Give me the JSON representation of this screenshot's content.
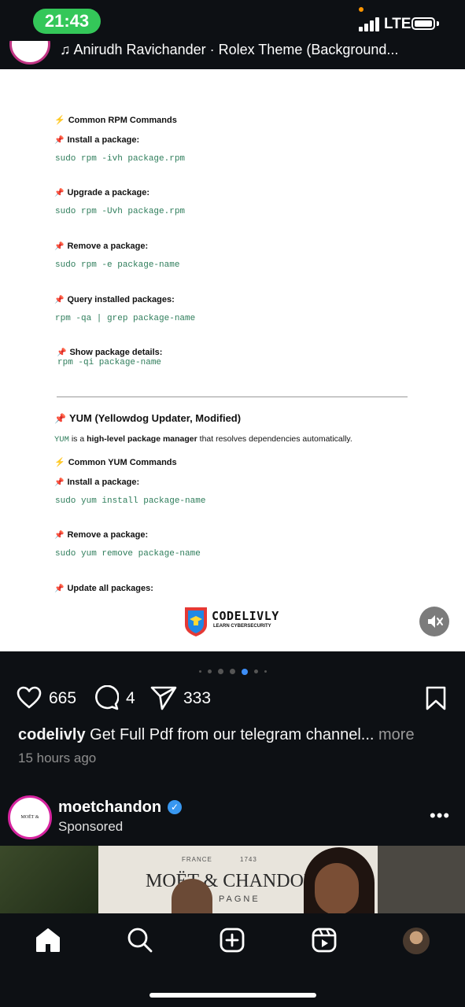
{
  "status_bar": {
    "time": "21:43",
    "network": "LTE"
  },
  "audio": {
    "text": "Anirudh Ravichander · Rolex Theme (Background..."
  },
  "post_image": {
    "common_rpm_heading": "Common RPM Commands",
    "rpm": [
      {
        "label": "Install a package:",
        "cmd": "sudo rpm -ivh package.rpm"
      },
      {
        "label": "Upgrade a package:",
        "cmd": "sudo rpm -Uvh package.rpm"
      },
      {
        "label": "Remove a package:",
        "cmd": "sudo rpm -e package-name"
      },
      {
        "label": "Query installed packages:",
        "cmd": "rpm -qa | grep package-name"
      },
      {
        "label": "Show package details:",
        "cmd": "rpm -qi package-name"
      }
    ],
    "yum_heading": "YUM (Yellowdog Updater, Modified)",
    "yum_intro_code": "YUM",
    "yum_intro_is": " is a ",
    "yum_intro_bold": "high-level package manager",
    "yum_intro_rest": " that resolves dependencies automatically.",
    "common_yum_heading": "Common YUM Commands",
    "yum": [
      {
        "label": "Install a package:",
        "cmd": "sudo yum install package-name"
      },
      {
        "label": "Remove a package:",
        "cmd": "sudo yum remove package-name"
      },
      {
        "label": "Update all packages:",
        "cmd": ""
      }
    ],
    "logo_title": "CODELIVLY",
    "logo_subtitle": "LEARN CYBERSECURITY"
  },
  "carousel": {
    "total_dots": 7,
    "active_index": 4
  },
  "actions": {
    "likes": "665",
    "comments": "4",
    "shares": "333"
  },
  "caption": {
    "username": "codelivly",
    "text": " Get Full Pdf from our telegram channel...",
    "more": " more",
    "time_ago": "15 hours ago"
  },
  "sponsored_post": {
    "username": "moetchandon",
    "label": "Sponsored",
    "avatar_text": "MOËT & CHANDON",
    "ad_france": "FRANCE",
    "ad_year": "1743",
    "ad_brand": "MOËT & CHANDON",
    "ad_sub": "PAGNE"
  },
  "colors": {
    "like_accent": "#f5f5f5",
    "verified": "#3897f0",
    "story_ring": "#d6249f",
    "status_green": "#34c759"
  },
  "icons": [
    "heart-icon",
    "comment-icon",
    "share-icon",
    "bookmark-icon",
    "home-icon",
    "search-icon",
    "create-icon",
    "reels-icon",
    "profile-avatar",
    "mute-icon",
    "music-icon",
    "more-icon"
  ]
}
